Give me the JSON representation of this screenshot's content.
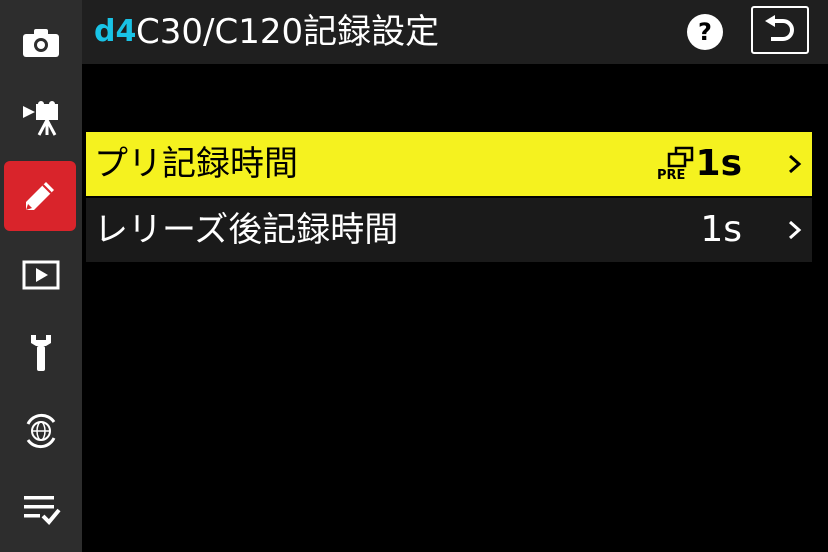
{
  "header": {
    "page_code": "d4",
    "title": "C30/C120記録設定",
    "help_label": "?"
  },
  "sidebar": {
    "items": [
      {
        "icon": "camera-icon"
      },
      {
        "icon": "video-camera-icon"
      },
      {
        "icon": "pencil-icon",
        "active": true
      },
      {
        "icon": "playback-icon"
      },
      {
        "icon": "wrench-icon"
      },
      {
        "icon": "network-globe-icon"
      },
      {
        "icon": "my-menu-icon"
      }
    ]
  },
  "menu": {
    "items": [
      {
        "label": "プリ記録時間",
        "value": "1s",
        "icon": "pre-capture-icon",
        "selected": true
      },
      {
        "label": "レリーズ後記録時間",
        "value": "1s",
        "selected": false
      }
    ]
  },
  "colors": {
    "accent_active": "#d9242b",
    "selection_highlight": "#f5f21f",
    "page_code": "#19c3e6"
  }
}
